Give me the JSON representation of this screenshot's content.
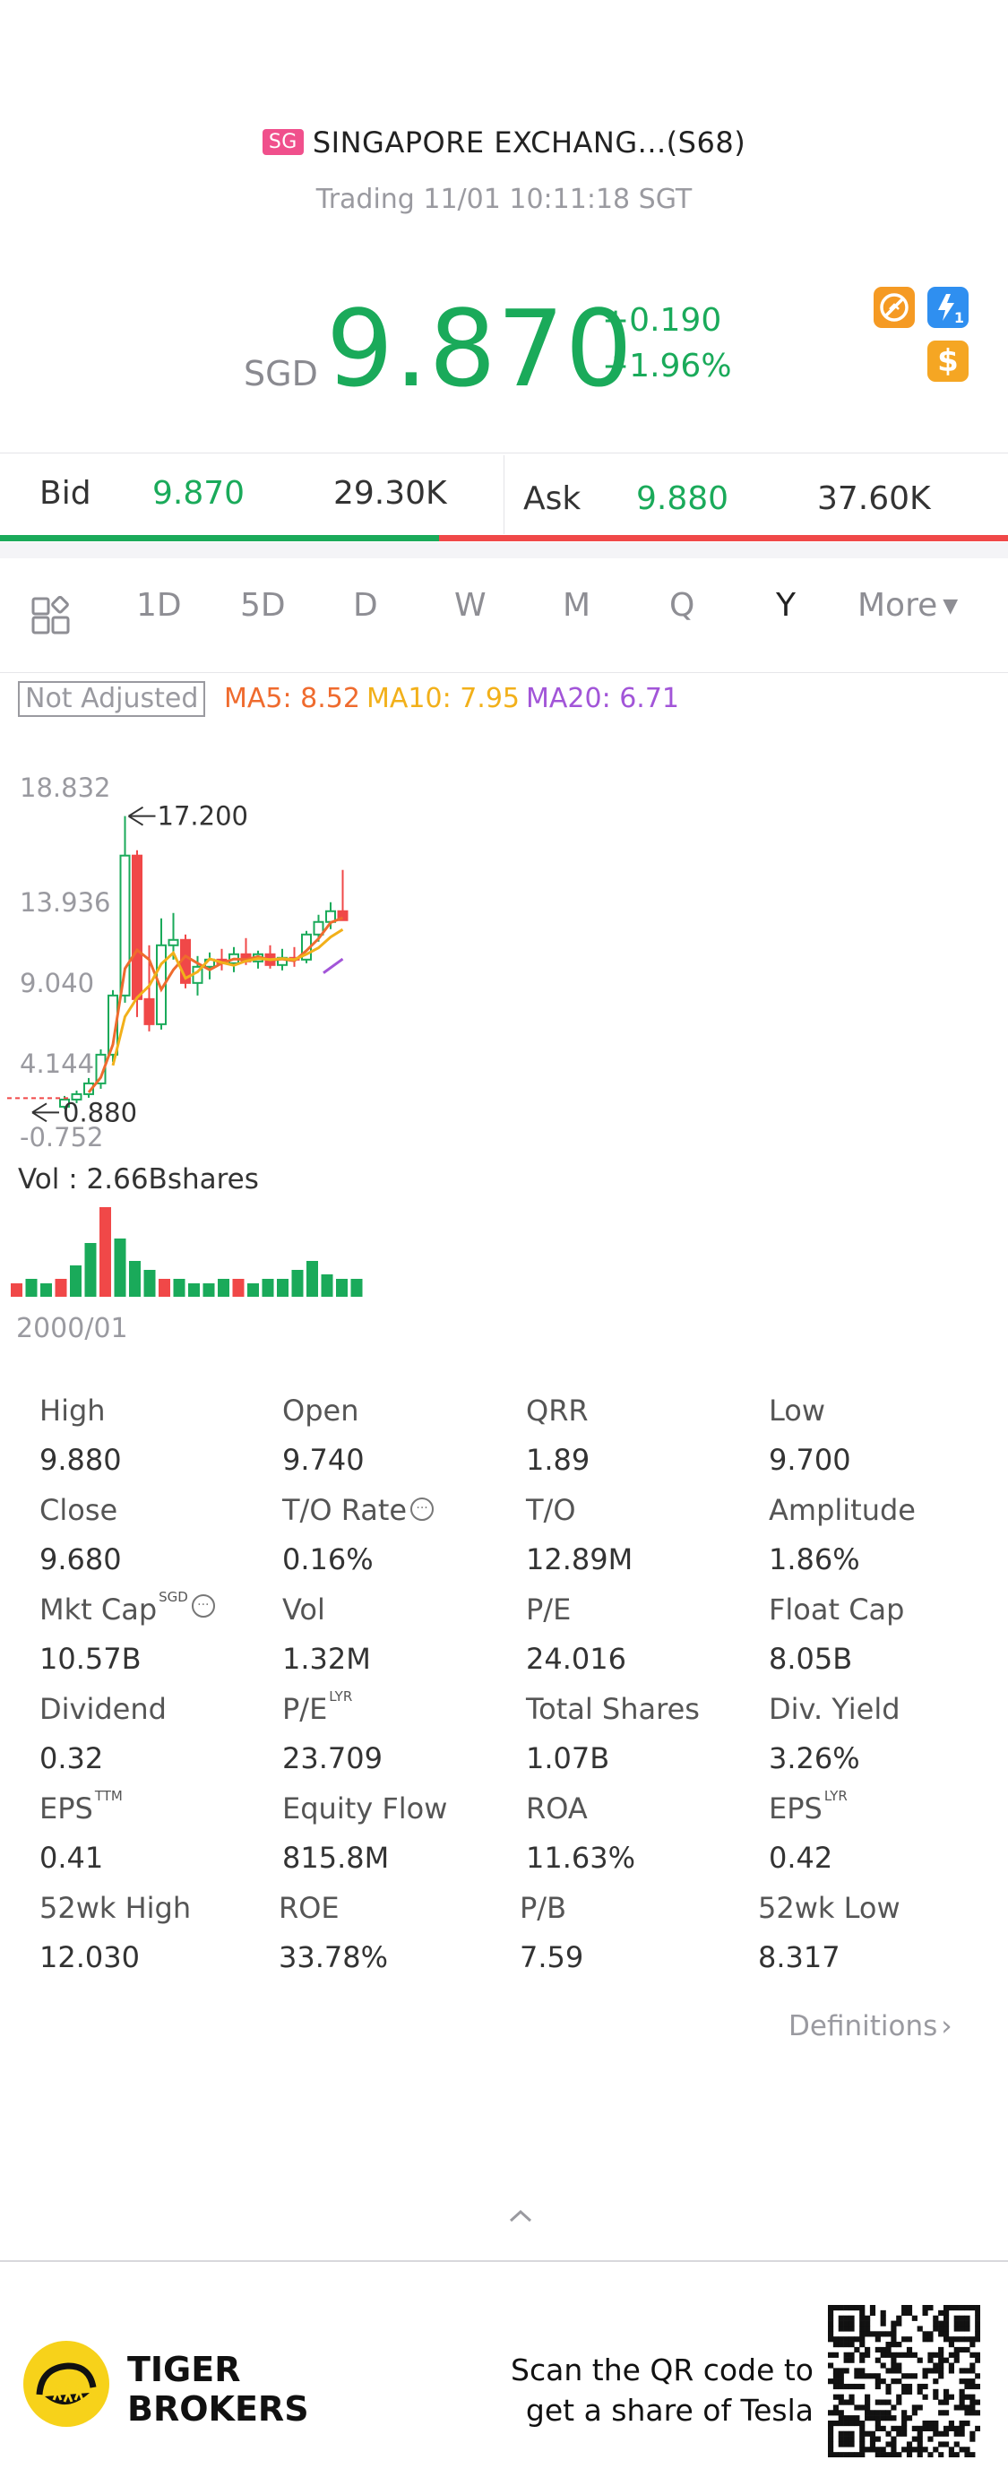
{
  "header": {
    "badge": "SG",
    "title": "SINGAPORE EXCHANG...(S68)",
    "status": "Trading 11/01 10:11:18 SGT"
  },
  "quote": {
    "currency": "SGD",
    "price": "9.870",
    "change": "+0.190",
    "change_pct": "+1.96%",
    "color_up": "#1aaa5a",
    "color_down": "#f04848",
    "icons": [
      "no-short-icon",
      "lightning-level1-icon",
      "dollar-icon"
    ],
    "lightning_label": "1",
    "dollar_label": "$"
  },
  "orderbook": {
    "bid_label": "Bid",
    "bid_price": "9.870",
    "bid_size": "29.30K",
    "ask_label": "Ask",
    "ask_price": "9.880",
    "ask_size": "37.60K",
    "bid_ratio": 0.4356
  },
  "tabs": {
    "items": [
      "1D",
      "5D",
      "D",
      "W",
      "M",
      "Q",
      "Y"
    ],
    "active": "Y",
    "more": "More"
  },
  "ma": {
    "adjust": "Not Adjusted",
    "ma5": "MA5: 8.52",
    "ma10": "MA10: 7.95",
    "ma20": "MA20: 6.71",
    "ma5_color": "#ef6b2e",
    "ma10_color": "#f2b01a",
    "ma20_color": "#a255d8"
  },
  "chart_data": {
    "type": "candlestick",
    "y_ticks": [
      "18.832",
      "13.936",
      "9.040",
      "4.144",
      "-0.752"
    ],
    "ylim": [
      -0.752,
      18.832
    ],
    "annotations": {
      "high": "17.200",
      "low": "0.880"
    },
    "x_label": "2000/01",
    "volume_label": "Vol  : 2.66Bshares",
    "candles": [
      {
        "o": 1.0,
        "h": 1.6,
        "l": 0.88,
        "c": 1.4
      },
      {
        "o": 1.4,
        "h": 1.9,
        "l": 1.2,
        "c": 1.7
      },
      {
        "o": 1.7,
        "h": 2.6,
        "l": 1.5,
        "c": 2.3
      },
      {
        "o": 2.3,
        "h": 4.2,
        "l": 2.0,
        "c": 3.9
      },
      {
        "o": 3.9,
        "h": 7.5,
        "l": 3.5,
        "c": 7.2
      },
      {
        "o": 7.2,
        "h": 17.2,
        "l": 6.8,
        "c": 15.0
      },
      {
        "o": 15.0,
        "h": 15.3,
        "l": 6.0,
        "c": 7.0
      },
      {
        "o": 7.0,
        "h": 10.0,
        "l": 5.2,
        "c": 5.6
      },
      {
        "o": 5.6,
        "h": 11.5,
        "l": 5.3,
        "c": 10.0
      },
      {
        "o": 10.0,
        "h": 11.8,
        "l": 9.2,
        "c": 10.3
      },
      {
        "o": 10.3,
        "h": 10.6,
        "l": 7.6,
        "c": 7.9
      },
      {
        "o": 7.9,
        "h": 9.4,
        "l": 7.2,
        "c": 8.8
      },
      {
        "o": 8.8,
        "h": 9.6,
        "l": 8.1,
        "c": 9.2
      },
      {
        "o": 9.2,
        "h": 9.8,
        "l": 8.6,
        "c": 9.0
      },
      {
        "o": 9.0,
        "h": 9.9,
        "l": 8.5,
        "c": 9.5
      },
      {
        "o": 9.5,
        "h": 10.4,
        "l": 8.9,
        "c": 9.1
      },
      {
        "o": 9.1,
        "h": 9.7,
        "l": 8.7,
        "c": 9.5
      },
      {
        "o": 9.5,
        "h": 10.0,
        "l": 8.7,
        "c": 8.9
      },
      {
        "o": 8.9,
        "h": 9.8,
        "l": 8.6,
        "c": 9.3
      },
      {
        "o": 9.3,
        "h": 9.9,
        "l": 8.8,
        "c": 9.2
      },
      {
        "o": 9.2,
        "h": 10.8,
        "l": 9.0,
        "c": 10.6
      },
      {
        "o": 10.6,
        "h": 11.7,
        "l": 10.2,
        "c": 11.3
      },
      {
        "o": 11.3,
        "h": 12.4,
        "l": 10.9,
        "c": 11.9
      },
      {
        "o": 11.9,
        "h": 14.2,
        "l": 11.4,
        "c": 11.4
      }
    ],
    "volume": [
      0.15,
      0.2,
      0.15,
      0.2,
      0.35,
      0.6,
      1.0,
      0.65,
      0.4,
      0.3,
      0.2,
      0.2,
      0.15,
      0.15,
      0.2,
      0.2,
      0.15,
      0.2,
      0.2,
      0.3,
      0.4,
      0.25,
      0.2,
      0.2
    ]
  },
  "stats": [
    [
      {
        "label": "High",
        "value": "9.880"
      },
      {
        "label": "Open",
        "value": "9.740"
      },
      {
        "label": "QRR",
        "value": "1.89"
      },
      {
        "label": "Low",
        "value": "9.700"
      }
    ],
    [
      {
        "label": "Close",
        "value": "9.680"
      },
      {
        "label": "T/O Rate",
        "value": "0.16%",
        "info": true
      },
      {
        "label": "T/O",
        "value": "12.89M"
      },
      {
        "label": "Amplitude",
        "value": "1.86%"
      }
    ],
    [
      {
        "label": "Mkt Cap",
        "value": "10.57B",
        "sup": "SGD",
        "info": true
      },
      {
        "label": "Vol",
        "value": "1.32M"
      },
      {
        "label": "P/E",
        "value": "24.016"
      },
      {
        "label": "Float Cap",
        "value": "8.05B"
      }
    ],
    [
      {
        "label": "Dividend",
        "value": "0.32"
      },
      {
        "label": "P/E",
        "value": "23.709",
        "sup": "LYR"
      },
      {
        "label": "Total Shares",
        "value": "1.07B"
      },
      {
        "label": "Div. Yield",
        "value": "3.26%"
      }
    ],
    [
      {
        "label": "EPS",
        "value": "0.41",
        "sup": "TTM"
      },
      {
        "label": "Equity Flow",
        "value": "815.8M"
      },
      {
        "label": "ROA",
        "value": "11.63%"
      },
      {
        "label": "EPS",
        "value": "0.42",
        "sup": "LYR"
      }
    ],
    [
      {
        "label": "52wk High",
        "value": "12.030"
      },
      {
        "label": "ROE",
        "value": "33.78%"
      },
      {
        "label": "P/B",
        "value": "7.59"
      },
      {
        "label": "52wk Low",
        "value": "8.317"
      }
    ]
  ],
  "definitions": "Definitions",
  "footer": {
    "brand_line1": "TIGER",
    "brand_line2": "BROKERS",
    "scan_line1": "Scan the QR code to",
    "scan_line2": "get a share of Tesla"
  }
}
